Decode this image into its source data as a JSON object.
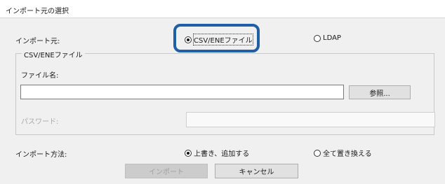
{
  "window": {
    "title": "インポート元の選択"
  },
  "source": {
    "label": "インポート元:",
    "options": [
      {
        "label": "CSV/ENEファイル",
        "selected": true
      },
      {
        "label": "LDAP",
        "selected": false
      }
    ]
  },
  "csv_group": {
    "legend": "CSV/ENEファイル",
    "filename_label": "ファイル名:",
    "filename_value": "",
    "browse_button": "参照...",
    "password_label": "パスワード:",
    "password_value": ""
  },
  "method": {
    "label": "インポート方法:",
    "options": [
      {
        "label": "上書き、追加する",
        "selected": true
      },
      {
        "label": "全て置き換える",
        "selected": false
      }
    ]
  },
  "buttons": {
    "import": "インポート",
    "cancel": "キャンセル"
  },
  "colors": {
    "highlight": "#1f5fa8",
    "dialog_bg": "#f0f0f0"
  }
}
